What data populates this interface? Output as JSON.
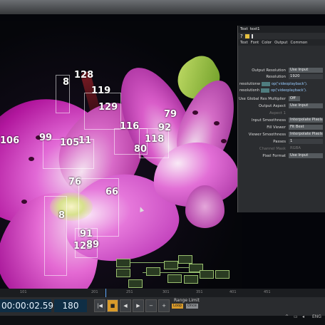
{
  "viewer": {
    "labels": [
      "128",
      "8",
      "119",
      "129",
      "116",
      "79",
      "92",
      "118",
      "80",
      "106",
      "99",
      "105",
      "11",
      "76",
      "66",
      "8",
      "91",
      "123",
      "89"
    ]
  },
  "panel": {
    "title_type": "Text",
    "title_name": "text1",
    "tabs": [
      "Text",
      "Font",
      "Color",
      "Output",
      "Common"
    ],
    "rows": [
      {
        "label": "Output Resolution",
        "value": "Use Input"
      },
      {
        "label": "Resolution",
        "value": "1920",
        "dim": false,
        "plain": true
      }
    ],
    "res_exprs": [
      "resolutionw",
      "resolutionh"
    ],
    "res_expr_values": [
      "op('videoplayback').",
      "op('videoplayback')."
    ],
    "rows2": [
      {
        "label": "Use Global Res Multiplier",
        "value": "Off"
      },
      {
        "label": "Output Aspect",
        "value": "Use Input"
      },
      {
        "label": "Aspect 1",
        "value": "",
        "dim": true
      },
      {
        "label": "Input Smoothness",
        "value": "Interpolate Pixels"
      },
      {
        "label": "Fill Viewer",
        "value": "Fit Best"
      },
      {
        "label": "Viewer Smoothness",
        "value": "Interpolate Pixels"
      },
      {
        "label": "Passes",
        "value": "1"
      },
      {
        "label": "Channel Mask",
        "value": "RGBA",
        "dim": true
      },
      {
        "label": "Pixel Format",
        "value": "Use Input"
      }
    ]
  },
  "ruler": {
    "ticks": [
      "101",
      "201",
      "251",
      "301",
      "351",
      "401",
      "451"
    ]
  },
  "timeline": {
    "timecode": "00:00:02.59",
    "frame": "180",
    "buttons": [
      "|◀",
      "■",
      "◀",
      "▶",
      "−",
      "+"
    ],
    "range_label": "Range Limit",
    "loop_label": "Loop",
    "once_label": "Once"
  },
  "tray": {
    "lang": "ENG"
  }
}
